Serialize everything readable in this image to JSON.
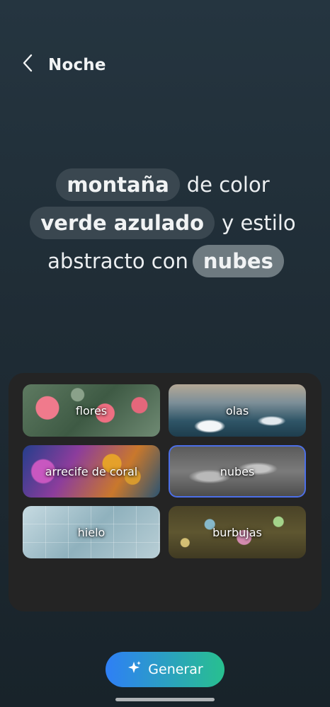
{
  "header": {
    "title": "Noche",
    "back_icon": "chevron-left-icon"
  },
  "prompt": {
    "line1": {
      "chip": "montaña",
      "text": "de color"
    },
    "line2": {
      "chip": "verde azulado",
      "text": "y estilo"
    },
    "line3": {
      "text": "abstracto con",
      "chip": "nubes"
    }
  },
  "options": [
    {
      "label": "flores",
      "selected": false
    },
    {
      "label": "olas",
      "selected": false
    },
    {
      "label": "arrecife de coral",
      "selected": false
    },
    {
      "label": "nubes",
      "selected": true
    },
    {
      "label": "hielo",
      "selected": false
    },
    {
      "label": "burbujas",
      "selected": false
    }
  ],
  "generate": {
    "label": "Generar",
    "icon": "sparkle-icon"
  },
  "colors": {
    "accent_start": "#2e7ff6",
    "accent_end": "#28c08f",
    "selected_border": "#4c6fe8",
    "chip_bg": "#3a4750",
    "chip_selected_bg": "#6e7a80"
  }
}
